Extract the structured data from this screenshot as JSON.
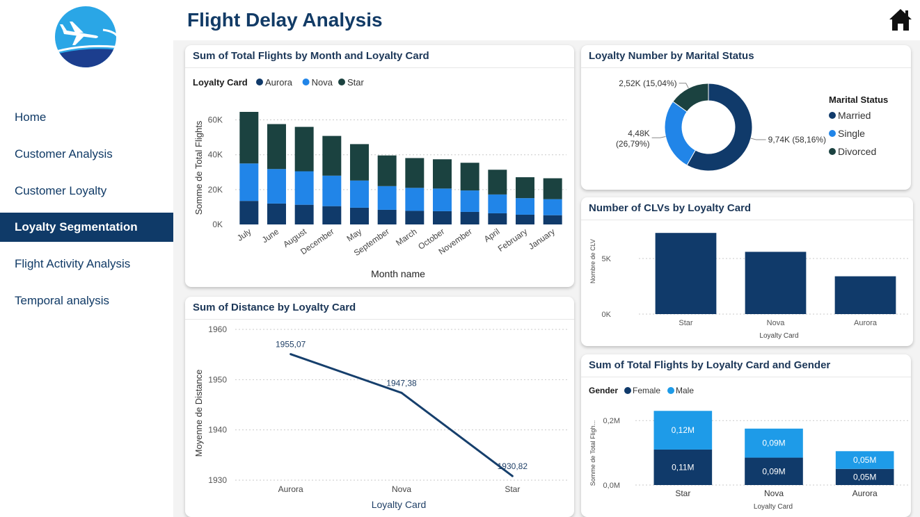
{
  "app": {
    "title": "Flight Delay Analysis",
    "home_icon": "home-icon",
    "logo_icon": "airplane-logo-icon"
  },
  "colors": {
    "navy": "#0f3a68",
    "blue": "#2185e8",
    "dark_green": "#1b4240",
    "light_blue": "#1e9be8",
    "header_text": "#123b66"
  },
  "sidebar": {
    "items": [
      {
        "label": "Home",
        "active": false
      },
      {
        "label": "Customer Analysis",
        "active": false
      },
      {
        "label": "Customer Loyalty",
        "active": false
      },
      {
        "label": "Loyalty Segmentation",
        "active": true
      },
      {
        "label": "Flight Activity Analysis",
        "active": false
      },
      {
        "label": "Temporal analysis",
        "active": false
      }
    ]
  },
  "charts": {
    "monthly": {
      "title": "Sum of Total Flights by Month and Loyalty Card",
      "legend_title": "Loyalty Card"
    },
    "marital": {
      "title": "Loyalty Number by Marital Status",
      "legend_title": "Marital Status"
    },
    "clv": {
      "title": "Number of CLVs by Loyalty Card"
    },
    "distance": {
      "title": "Sum of Distance by Loyalty Card"
    },
    "gender": {
      "title": "Sum of Total Flights by Loyalty Card and Gender",
      "legend_title": "Gender"
    }
  },
  "chart_data": [
    {
      "id": "monthly",
      "type": "bar",
      "stacked": true,
      "title": "Sum of Total Flights by Month and Loyalty Card",
      "xlabel": "Month name",
      "ylabel": "Somme de Total Flights",
      "ylim": [
        0,
        65000
      ],
      "yticks": [
        0,
        20000,
        40000,
        60000
      ],
      "ytick_labels": [
        "0K",
        "20K",
        "40K",
        "60K"
      ],
      "grid": true,
      "legend": "top-left",
      "categories": [
        "July",
        "June",
        "August",
        "December",
        "May",
        "September",
        "March",
        "October",
        "November",
        "April",
        "February",
        "January"
      ],
      "series": [
        {
          "name": "Aurora",
          "color": "#103a6a",
          "values": [
            13500,
            12000,
            11300,
            10500,
            9600,
            8400,
            7800,
            7600,
            7200,
            6400,
            5600,
            5300
          ]
        },
        {
          "name": "Nova",
          "color": "#2185e8",
          "values": [
            21500,
            19800,
            19200,
            17500,
            15600,
            13600,
            13200,
            13000,
            12300,
            10800,
            9500,
            9200
          ]
        },
        {
          "name": "Star",
          "color": "#1b4240",
          "values": [
            29600,
            25800,
            25500,
            22800,
            20900,
            17600,
            17100,
            16800,
            15900,
            14200,
            12000,
            12000
          ]
        }
      ]
    },
    {
      "id": "marital",
      "type": "pie",
      "donut": true,
      "title": "Loyalty Number by Marital Status",
      "legend": "right",
      "slices": [
        {
          "name": "Married",
          "value": 9740,
          "pct": 58.16,
          "label": "9,74K (58,16%)",
          "color": "#103a6a"
        },
        {
          "name": "Single",
          "value": 4480,
          "pct": 26.79,
          "label_lines": [
            "4,48K",
            "(26,79%)"
          ],
          "color": "#2185e8"
        },
        {
          "name": "Divorced",
          "value": 2520,
          "pct": 15.04,
          "label": "2,52K (15,04%)",
          "color": "#1b4240"
        }
      ]
    },
    {
      "id": "clv",
      "type": "bar",
      "title": "Number of CLVs by Loyalty Card",
      "xlabel": "Loyalty Card",
      "ylabel": "Nombre de CLV",
      "categories": [
        "Star",
        "Nova",
        "Aurora"
      ],
      "values": [
        7300,
        5600,
        3400
      ],
      "ylim": [
        0,
        8000
      ],
      "yticks": [
        0,
        5000
      ],
      "ytick_labels": [
        "0K",
        "5K"
      ],
      "grid": true
    },
    {
      "id": "distance",
      "type": "line",
      "title": "Sum of Distance by Loyalty Card",
      "xlabel": "Loyalty Card",
      "ylabel": "Moyenne de Distance",
      "categories": [
        "Aurora",
        "Nova",
        "Star"
      ],
      "values": [
        1955.07,
        1947.38,
        1930.82
      ],
      "data_labels": [
        "1955,07",
        "1947,38",
        "1930,82"
      ],
      "ylim": [
        1930,
        1960
      ],
      "yticks": [
        1930,
        1940,
        1950,
        1960
      ],
      "grid": true
    },
    {
      "id": "gender",
      "type": "bar",
      "stacked": true,
      "title": "Sum of Total Flights by Loyalty Card and Gender",
      "xlabel": "Loyalty Card",
      "ylabel": "Somme de Total Fligh...",
      "categories": [
        "Star",
        "Nova",
        "Aurora"
      ],
      "ylim": [
        0,
        0.25
      ],
      "yticks": [
        0,
        0.2
      ],
      "ytick_labels": [
        "0,0M",
        "0,2M"
      ],
      "grid": true,
      "legend": "top-left",
      "series": [
        {
          "name": "Female",
          "color": "#103a6a",
          "values": [
            0.11,
            0.085,
            0.05
          ],
          "labels": [
            "0,11M",
            "0,09M",
            "0,05M"
          ]
        },
        {
          "name": "Male",
          "color": "#1e9be8",
          "values": [
            0.12,
            0.09,
            0.055
          ],
          "labels": [
            "0,12M",
            "0,09M",
            "0,05M"
          ]
        }
      ]
    }
  ]
}
